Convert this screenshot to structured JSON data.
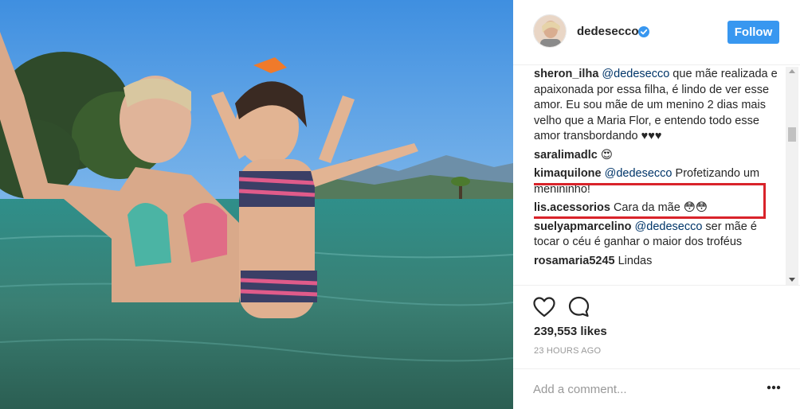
{
  "post": {
    "username": "dedesecco",
    "verified": true,
    "follow_label": "Follow",
    "likes": "239,553 likes",
    "time_ago": "23 HOURS AGO",
    "add_comment_placeholder": "Add a comment..."
  },
  "comments": [
    {
      "user": "sheron_ilha",
      "mention": "@dedesecco",
      "text": " que mãe realizada e apaixonada por essa filha, é lindo de ver esse amor. Eu sou mãe de um menino 2 dias mais velho que a Maria Flor, e entendo todo esse amor transbordando ♥♥♥"
    },
    {
      "user": "saralimadlc",
      "mention": "",
      "text": " 😍"
    },
    {
      "user": "kimaquilone",
      "mention": "@dedesecco",
      "text": " Profetizando um menininho!"
    },
    {
      "user": "lis.acessorios",
      "mention": "",
      "text": " Cara da mãe 😳😳"
    },
    {
      "user": "suelyapmarcelino",
      "mention": "@dedesecco",
      "text": " ser mãe é tocar o céu é ganhar o maior dos troféus"
    },
    {
      "user": "rosamaria5245",
      "mention": "",
      "text": " Lindas"
    }
  ],
  "colors": {
    "follow_button": "#3897f0",
    "verified_badge": "#3897f0",
    "highlight_box": "#d9232a",
    "mention": "#003569"
  },
  "icons": [
    "verified-badge-icon",
    "heart-icon",
    "comment-icon",
    "more-options-icon"
  ]
}
